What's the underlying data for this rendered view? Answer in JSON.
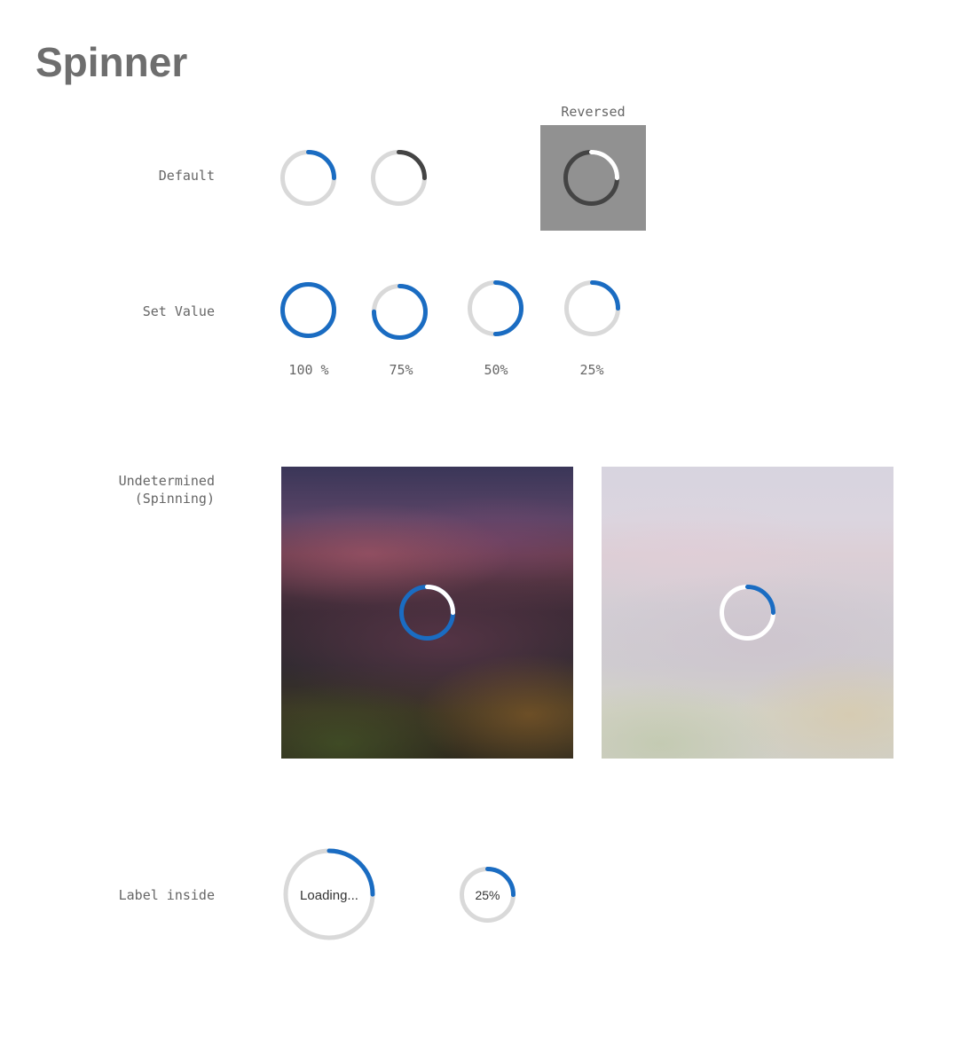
{
  "page": {
    "title": "Spinner"
  },
  "reversed_label": "Reversed",
  "sections": {
    "default": {
      "label": "Default"
    },
    "set_value": {
      "label": "Set Value",
      "items": [
        {
          "caption": "100 %",
          "value": 1.0
        },
        {
          "caption": "75%",
          "value": 0.75
        },
        {
          "caption": "50%",
          "value": 0.5
        },
        {
          "caption": "25%",
          "value": 0.25
        }
      ]
    },
    "undetermined": {
      "label_line1": "Undetermined",
      "label_line2": "(Spinning)"
    },
    "label_inside": {
      "label": "Label inside",
      "loading_text": "Loading...",
      "percent_text": "25%",
      "percent_value": 0.25
    }
  },
  "colors": {
    "accent": "#1a6cc2",
    "track": "#d9d9d9",
    "dark_arc": "#444444",
    "reversed_background": "#919191",
    "white": "#ffffff",
    "label_text": "#666666",
    "title_text": "#6e6e6e"
  }
}
